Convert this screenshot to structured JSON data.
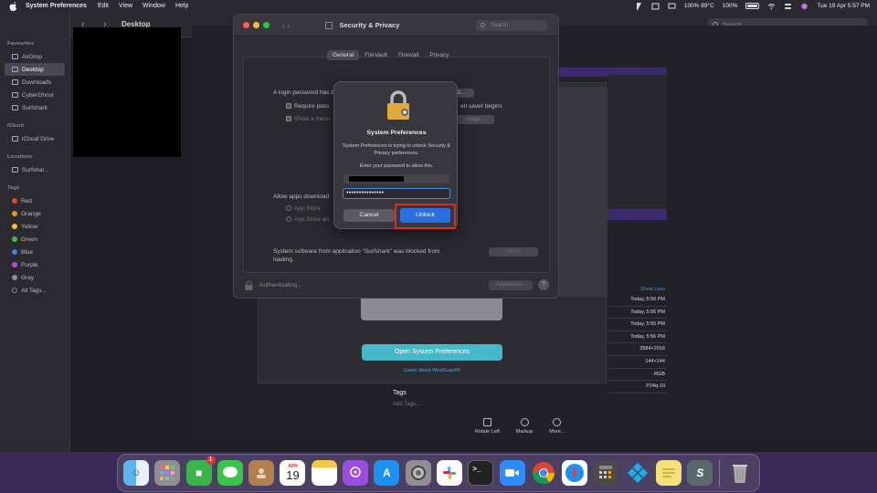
{
  "menubar": {
    "app": "System Preferences",
    "items": [
      "Edit",
      "View",
      "Window",
      "Help"
    ],
    "status": {
      "temp": "100% 89°C",
      "battery": "100%",
      "datetime": "Tue 19 Apr  5:57 PM"
    }
  },
  "finder": {
    "title": "Desktop",
    "search_placeholder": "Search",
    "sidebar": {
      "favourites_heading": "Favourites",
      "favourites": [
        "AirDrop",
        "Desktop",
        "Downloads",
        "CyberGhost",
        "Surfshark"
      ],
      "icloud_heading": "iCloud",
      "icloud": [
        "iCloud Drive"
      ],
      "locations_heading": "Locations",
      "locations": [
        "Surfshar..."
      ],
      "tags_heading": "Tags",
      "tags": [
        {
          "label": "Red",
          "color": "#e0443a"
        },
        {
          "label": "Orange",
          "color": "#e8902a"
        },
        {
          "label": "Yellow",
          "color": "#e8c62a"
        },
        {
          "label": "Green",
          "color": "#3fb950"
        },
        {
          "label": "Blue",
          "color": "#3f7fe0"
        },
        {
          "label": "Purple",
          "color": "#a05ad8"
        },
        {
          "label": "Gray",
          "color": "#8e8e93"
        }
      ],
      "all_tags": "All Tags..."
    }
  },
  "preview": {
    "show_less": "Show Less",
    "info_rows": [
      "Today, 5:56 PM",
      "Today, 5:56 PM",
      "Today, 5:56 PM",
      "Today, 5:56 PM",
      "3584×2016",
      "144×144",
      "RGB",
      "P24q-10"
    ],
    "open_button": "Open System Preferences",
    "learn_link": "Learn about WireGuard®",
    "tags_label": "Tags",
    "add_tags": "Add Tags...",
    "tools": [
      "Rotate Left",
      "Markup",
      "More..."
    ]
  },
  "security": {
    "title": "Security & Privacy",
    "search_placeholder": "Search",
    "tabs": [
      "General",
      "FileVault",
      "Firewall",
      "Privacy"
    ],
    "selected_tab": "General",
    "login_text": "A login password has been set for this user",
    "change_password": "Change Password...",
    "require_pass": "Require pass",
    "screen_saver": "en saver begins",
    "show_msg": "Show a mess",
    "lock_msg": "ssage...",
    "allow_apps": "Allow apps download",
    "app_store": "App Store",
    "app_store_identified": "App Store an",
    "blocked_text": "System software from application \"Surfshark\" was blocked from loading.",
    "allow_btn": "Allow",
    "authenticating": "Authenticating...",
    "advanced": "Advanced...",
    "help": "?"
  },
  "dialog": {
    "title": "System Preferences",
    "message": "System Preferences is trying to unlock Security & Privacy preferences.",
    "prompt": "Enter your password to allow this.",
    "password_value": "•••••••••••••••",
    "cancel": "Cancel",
    "unlock": "Unlock",
    "highlight_color": "#e02a1f"
  },
  "dock": {
    "calendar_month": "APR",
    "calendar_day": "19",
    "facetime_badge": "1",
    "apps": [
      "finder-icon",
      "launchpad-icon",
      "facetime-icon",
      "messages-icon",
      "contacts-icon",
      "calendar-icon",
      "notes-icon",
      "podcasts-icon",
      "app-store-icon",
      "system-preferences-icon",
      "slack-icon",
      "terminal-icon",
      "zoom-icon",
      "chrome-icon",
      "safari-icon",
      "calculator-icon",
      "kodi-icon",
      "stickies-icon",
      "surfshark-icon",
      "trash-icon"
    ]
  }
}
